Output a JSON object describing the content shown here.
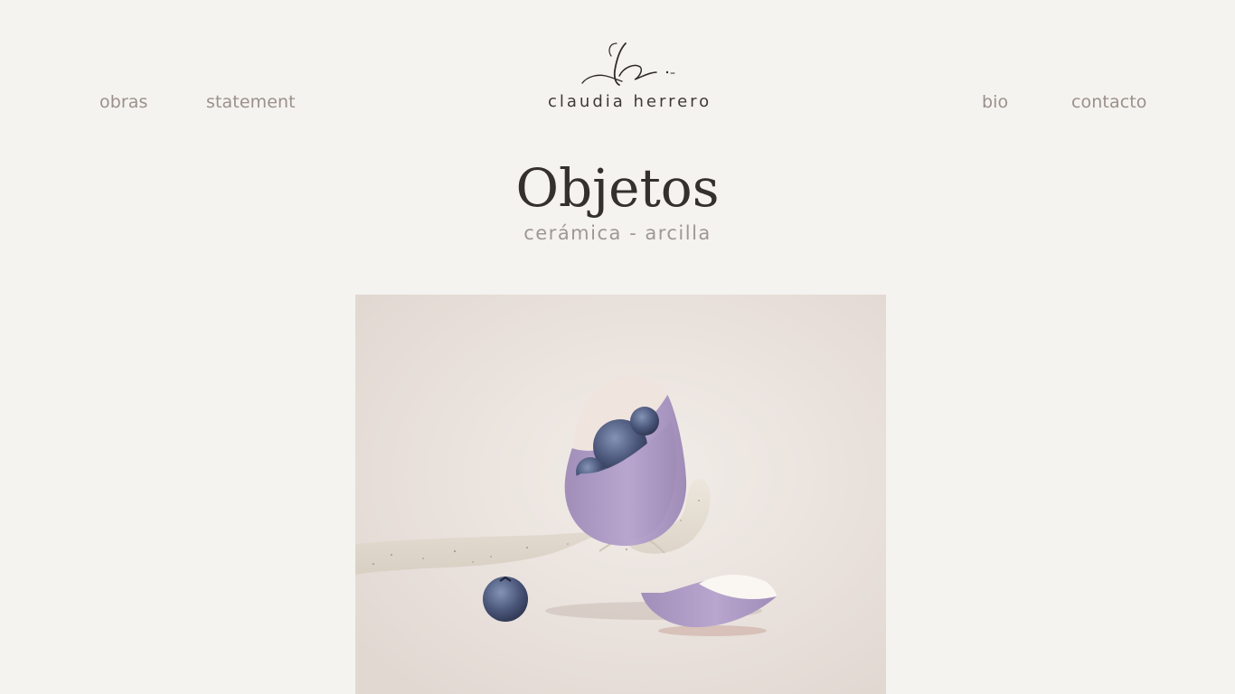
{
  "nav": {
    "left": [
      {
        "label": "obras"
      },
      {
        "label": "statement"
      }
    ],
    "right": [
      {
        "label": "bio"
      },
      {
        "label": "contacto"
      }
    ]
  },
  "logo": {
    "text": "claudia herrero",
    "icon": "signature-logo-icon"
  },
  "page": {
    "title": "Objetos",
    "subtitle": "cerámica - arcilla"
  },
  "artwork": {
    "icon": "ceramic-hand-egg-blueberries-image"
  },
  "colors": {
    "background": "#f5f3ef",
    "nav_text": "#9b908b",
    "title_text": "#34302d",
    "subtitle_text": "#9e9895",
    "egg_lavender": "#b3a0c9"
  }
}
